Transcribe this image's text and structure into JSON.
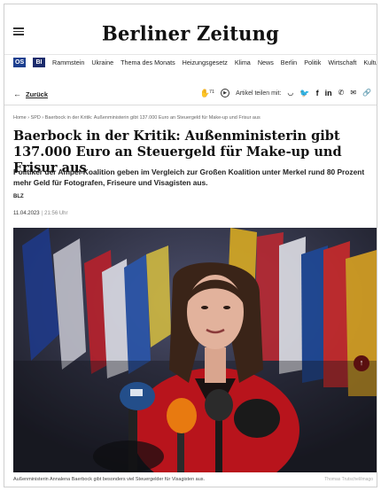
{
  "header": {
    "logo": "Berliner Zeitung",
    "menu_icon": "hamburger-menu-icon"
  },
  "nav": {
    "badges": [
      "OS",
      "BI"
    ],
    "items": [
      "Rammstein",
      "Ukraine",
      "Thema des Monats",
      "Heizungsgesetz",
      "Klima",
      "News",
      "Berlin",
      "Politik",
      "Wirtschaft",
      "Kultur"
    ]
  },
  "toolbar": {
    "back_label": "Zurück",
    "comment_count": "71",
    "share_label": "Artikel teilen mit:"
  },
  "breadcrumb": "Home › SPD › Baerbock in der Kritik: Außenministerin gibt 137.000 Euro an Steuergeld für Make-up und Frisur aus",
  "article": {
    "headline": "Baerbock in der Kritik: Außenministerin gibt 137.000 Euro an Steuergeld für Make-up und Frisur aus",
    "lead": "Politiker der Ampel-Koalition geben im Vergleich zur Großen Koalition unter Merkel rund 80 Prozent mehr Geld für Fotografen, Friseure und Visagisten aus.",
    "author": "BLZ",
    "date": "11.04.2023",
    "time": "21:56 Uhr",
    "caption": "Außenministerin Annalena Baerbock gibt besonders viel Steuergelder für Visagisten aus.",
    "credit": "Thomas Trutschel/imago"
  },
  "colors": {
    "accent": "#5a1010",
    "nav_badge": "#1c3f8f"
  }
}
